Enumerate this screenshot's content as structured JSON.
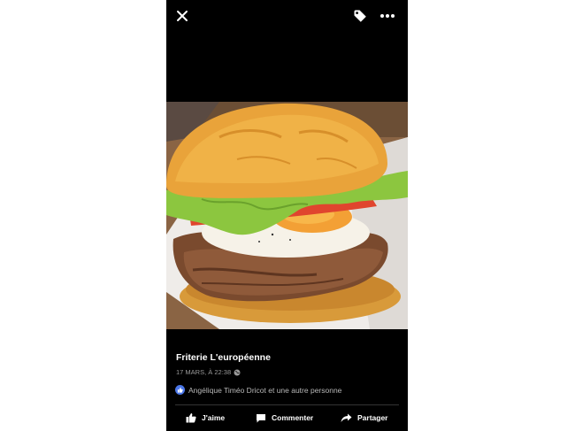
{
  "header": {
    "close_icon": "close-icon",
    "tag_icon": "tag-icon",
    "more_icon": "more-horizontal-icon"
  },
  "photo": {
    "subject": "burger-image"
  },
  "post": {
    "page_name": "Friterie L'européenne",
    "timestamp": "17 MARS, À 22:38",
    "privacy_icon": "globe-icon"
  },
  "reactions": {
    "text": "Angélique Timéo Dricot et une autre personne",
    "icon": "like-badge-icon",
    "color": "#4a76e8"
  },
  "actions": {
    "like": "J'aime",
    "comment": "Commenter",
    "share": "Partager"
  }
}
